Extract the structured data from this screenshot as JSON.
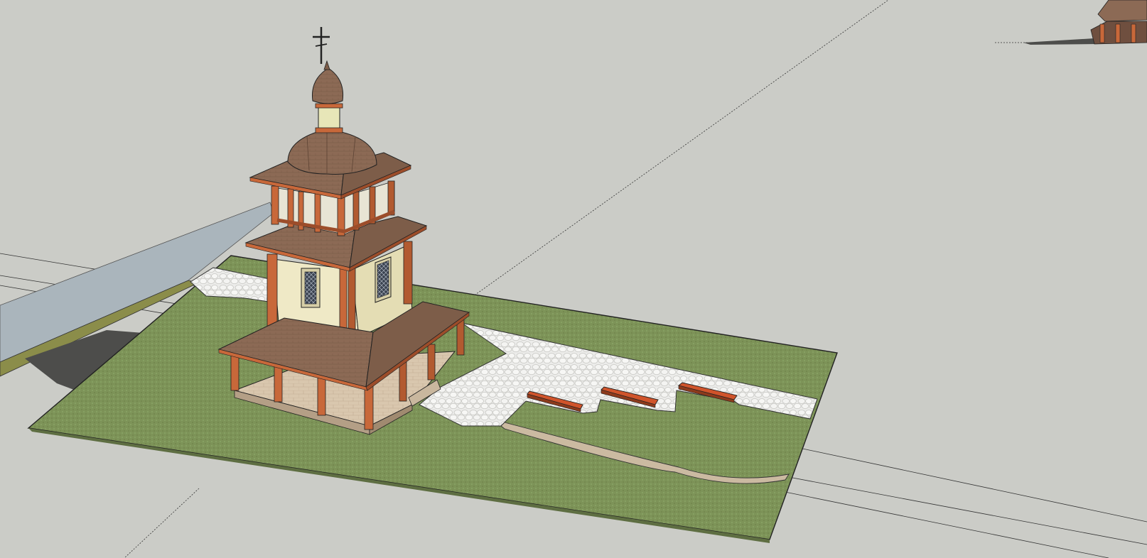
{
  "viewport": {
    "background": "#cbccc7"
  },
  "colors": {
    "grass": "#7d9358",
    "grass_dark": "#6f8450",
    "paving": "#e9e9e7",
    "paving_stone_edge": "#c6c6c2",
    "water": "#aab5bc",
    "shadow": "#4d4d4b",
    "roof": "#8c6a55",
    "roof_dark": "#6f4f3f",
    "wall": "#efe9c6",
    "wall_shade": "#e4ddb4",
    "timber": "#c8683a",
    "timber_dark": "#9c4d2a",
    "bench": "#d0542b",
    "path_curb": "#c9b9a0"
  }
}
